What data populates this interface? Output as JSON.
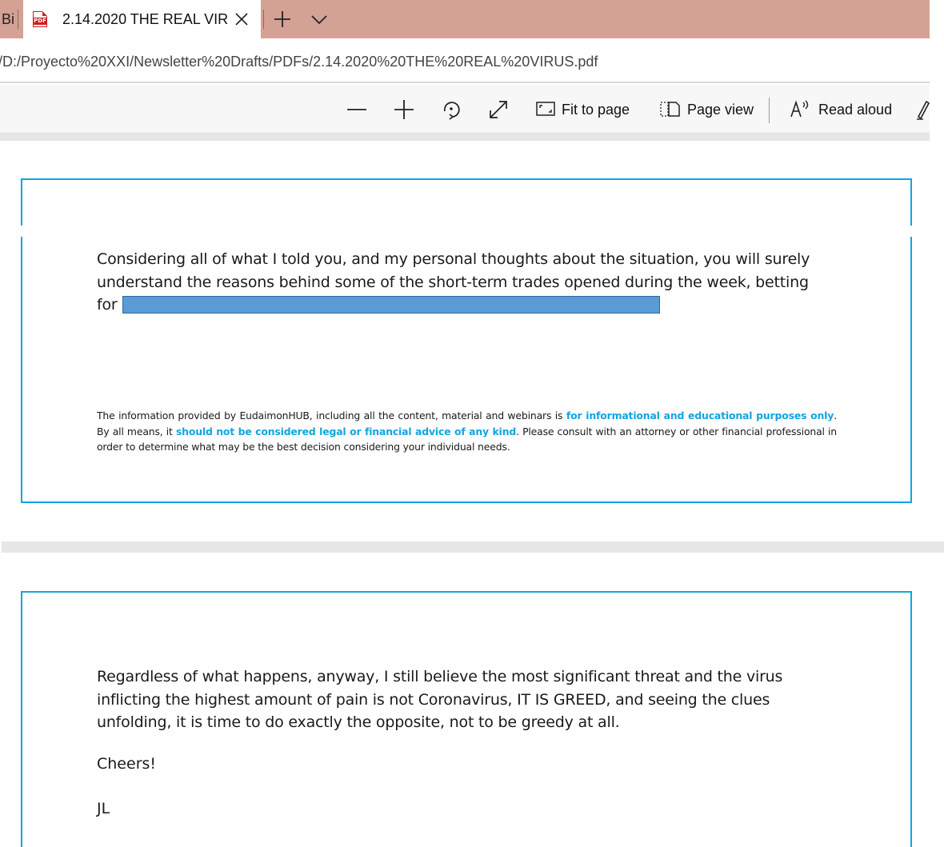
{
  "tabs": {
    "previous_fragment": "Bi",
    "active_title": "2.14.2020 THE REAL VIR",
    "pdf_badge": "PDF"
  },
  "address": {
    "url": "/D:/Proyecto%20XXI/Newsletter%20Drafts/PDFs/2.14.2020%20THE%20REAL%20VIRUS.pdf"
  },
  "toolbar": {
    "fit_label": "Fit to page",
    "page_view_label": "Page view",
    "read_aloud_label": "Read aloud"
  },
  "page1": {
    "line1": "Considering all of what I told you, and my personal thoughts about the situation, you will surely",
    "line2": "understand the reasons behind some of the short-term trades opened during the week, betting",
    "line3": "for",
    "disclaimer": {
      "part1": "The information provided by EudaimonHUB, including all the content, material and webinars is ",
      "highlight1": "for informational and educational purposes only",
      "part2": ". By all means, it ",
      "highlight2": "should not be considered legal or financial advice of any kind",
      "part3": ". Please consult with an attorney or other financial professional in order to determine what may be the best decision considering your individual needs."
    }
  },
  "page2": {
    "line1": "Regardless of what happens, anyway, I still believe the most significant threat and the virus",
    "line2": "inflicting the highest amount of pain is not Coronavirus, IT IS GREED, and seeing the clues",
    "line3": "unfolding, it is time to do exactly the opposite, not to be greedy at all.",
    "cheers": "Cheers!",
    "signature": "JL"
  },
  "colors": {
    "tab_strip": "#d4a195",
    "page_border": "#12a4e0",
    "redaction": "#5b9bd5",
    "pdf_icon": "#c9201f"
  }
}
